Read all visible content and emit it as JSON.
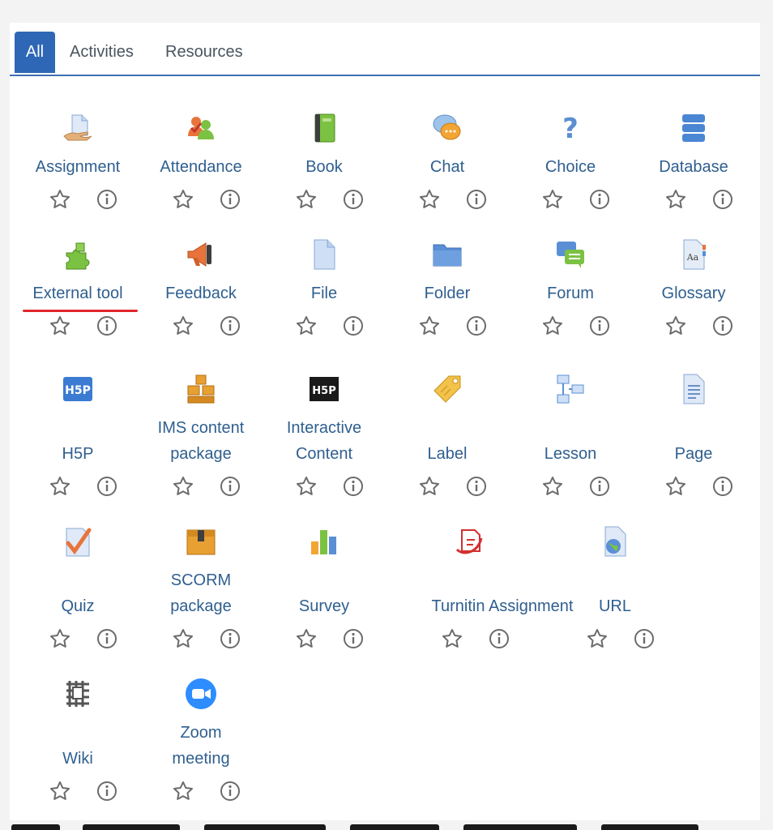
{
  "tabs": [
    {
      "label": "All",
      "active": true
    },
    {
      "label": "Activities",
      "active": false
    },
    {
      "label": "Resources",
      "active": false
    }
  ],
  "rows": [
    [
      {
        "name": "assignment",
        "label_lines": [
          "Assignment"
        ],
        "icon": "assignment-icon"
      },
      {
        "name": "attendance",
        "label_lines": [
          "Attendance"
        ],
        "icon": "attendance-icon"
      },
      {
        "name": "book",
        "label_lines": [
          "Book"
        ],
        "icon": "book-icon"
      },
      {
        "name": "chat",
        "label_lines": [
          "Chat"
        ],
        "icon": "chat-icon"
      },
      {
        "name": "choice",
        "label_lines": [
          "Choice"
        ],
        "icon": "choice-icon"
      },
      {
        "name": "database",
        "label_lines": [
          "Database"
        ],
        "icon": "database-icon"
      }
    ],
    [
      {
        "name": "external-tool",
        "label_lines": [
          "External tool"
        ],
        "icon": "external-tool-icon",
        "highlighted": true
      },
      {
        "name": "feedback",
        "label_lines": [
          "Feedback"
        ],
        "icon": "feedback-icon"
      },
      {
        "name": "file",
        "label_lines": [
          "File"
        ],
        "icon": "file-icon"
      },
      {
        "name": "folder",
        "label_lines": [
          "Folder"
        ],
        "icon": "folder-icon"
      },
      {
        "name": "forum",
        "label_lines": [
          "Forum"
        ],
        "icon": "forum-icon"
      },
      {
        "name": "glossary",
        "label_lines": [
          "Glossary"
        ],
        "icon": "glossary-icon"
      }
    ],
    [
      {
        "name": "h5p",
        "label_lines": [
          "H5P"
        ],
        "icon": "h5p-icon"
      },
      {
        "name": "ims-content-package",
        "label_lines": [
          "IMS content",
          "package"
        ],
        "icon": "ims-package-icon"
      },
      {
        "name": "interactive-content",
        "label_lines": [
          "Interactive",
          "Content"
        ],
        "icon": "interactive-content-icon"
      },
      {
        "name": "label",
        "label_lines": [
          "Label"
        ],
        "icon": "label-icon"
      },
      {
        "name": "lesson",
        "label_lines": [
          "Lesson"
        ],
        "icon": "lesson-icon"
      },
      {
        "name": "page",
        "label_lines": [
          "Page"
        ],
        "icon": "page-icon"
      }
    ],
    [
      {
        "name": "quiz",
        "label_lines": [
          "Quiz"
        ],
        "icon": "quiz-icon"
      },
      {
        "name": "scorm-package",
        "label_lines": [
          "SCORM",
          "package"
        ],
        "icon": "scorm-icon"
      },
      {
        "name": "survey",
        "label_lines": [
          "Survey"
        ],
        "icon": "survey-icon"
      },
      {
        "name": "turnitin-assignment",
        "label_lines": [
          "Turnitin Assignment"
        ],
        "icon": "turnitin-icon"
      },
      {
        "name": "url",
        "label_lines": [
          "URL"
        ],
        "icon": "url-icon"
      }
    ],
    [
      {
        "name": "wiki",
        "label_lines": [
          "Wiki"
        ],
        "icon": "wiki-icon"
      },
      {
        "name": "zoom-meeting",
        "label_lines": [
          "Zoom",
          "meeting"
        ],
        "icon": "zoom-icon"
      }
    ]
  ],
  "action_icons": {
    "star": "star-icon",
    "info": "info-icon"
  },
  "colors": {
    "accent": "#2e67b6",
    "link": "#2f5f8f",
    "highlight": "#e0262c",
    "icon_grey": "#6b6b6b"
  }
}
